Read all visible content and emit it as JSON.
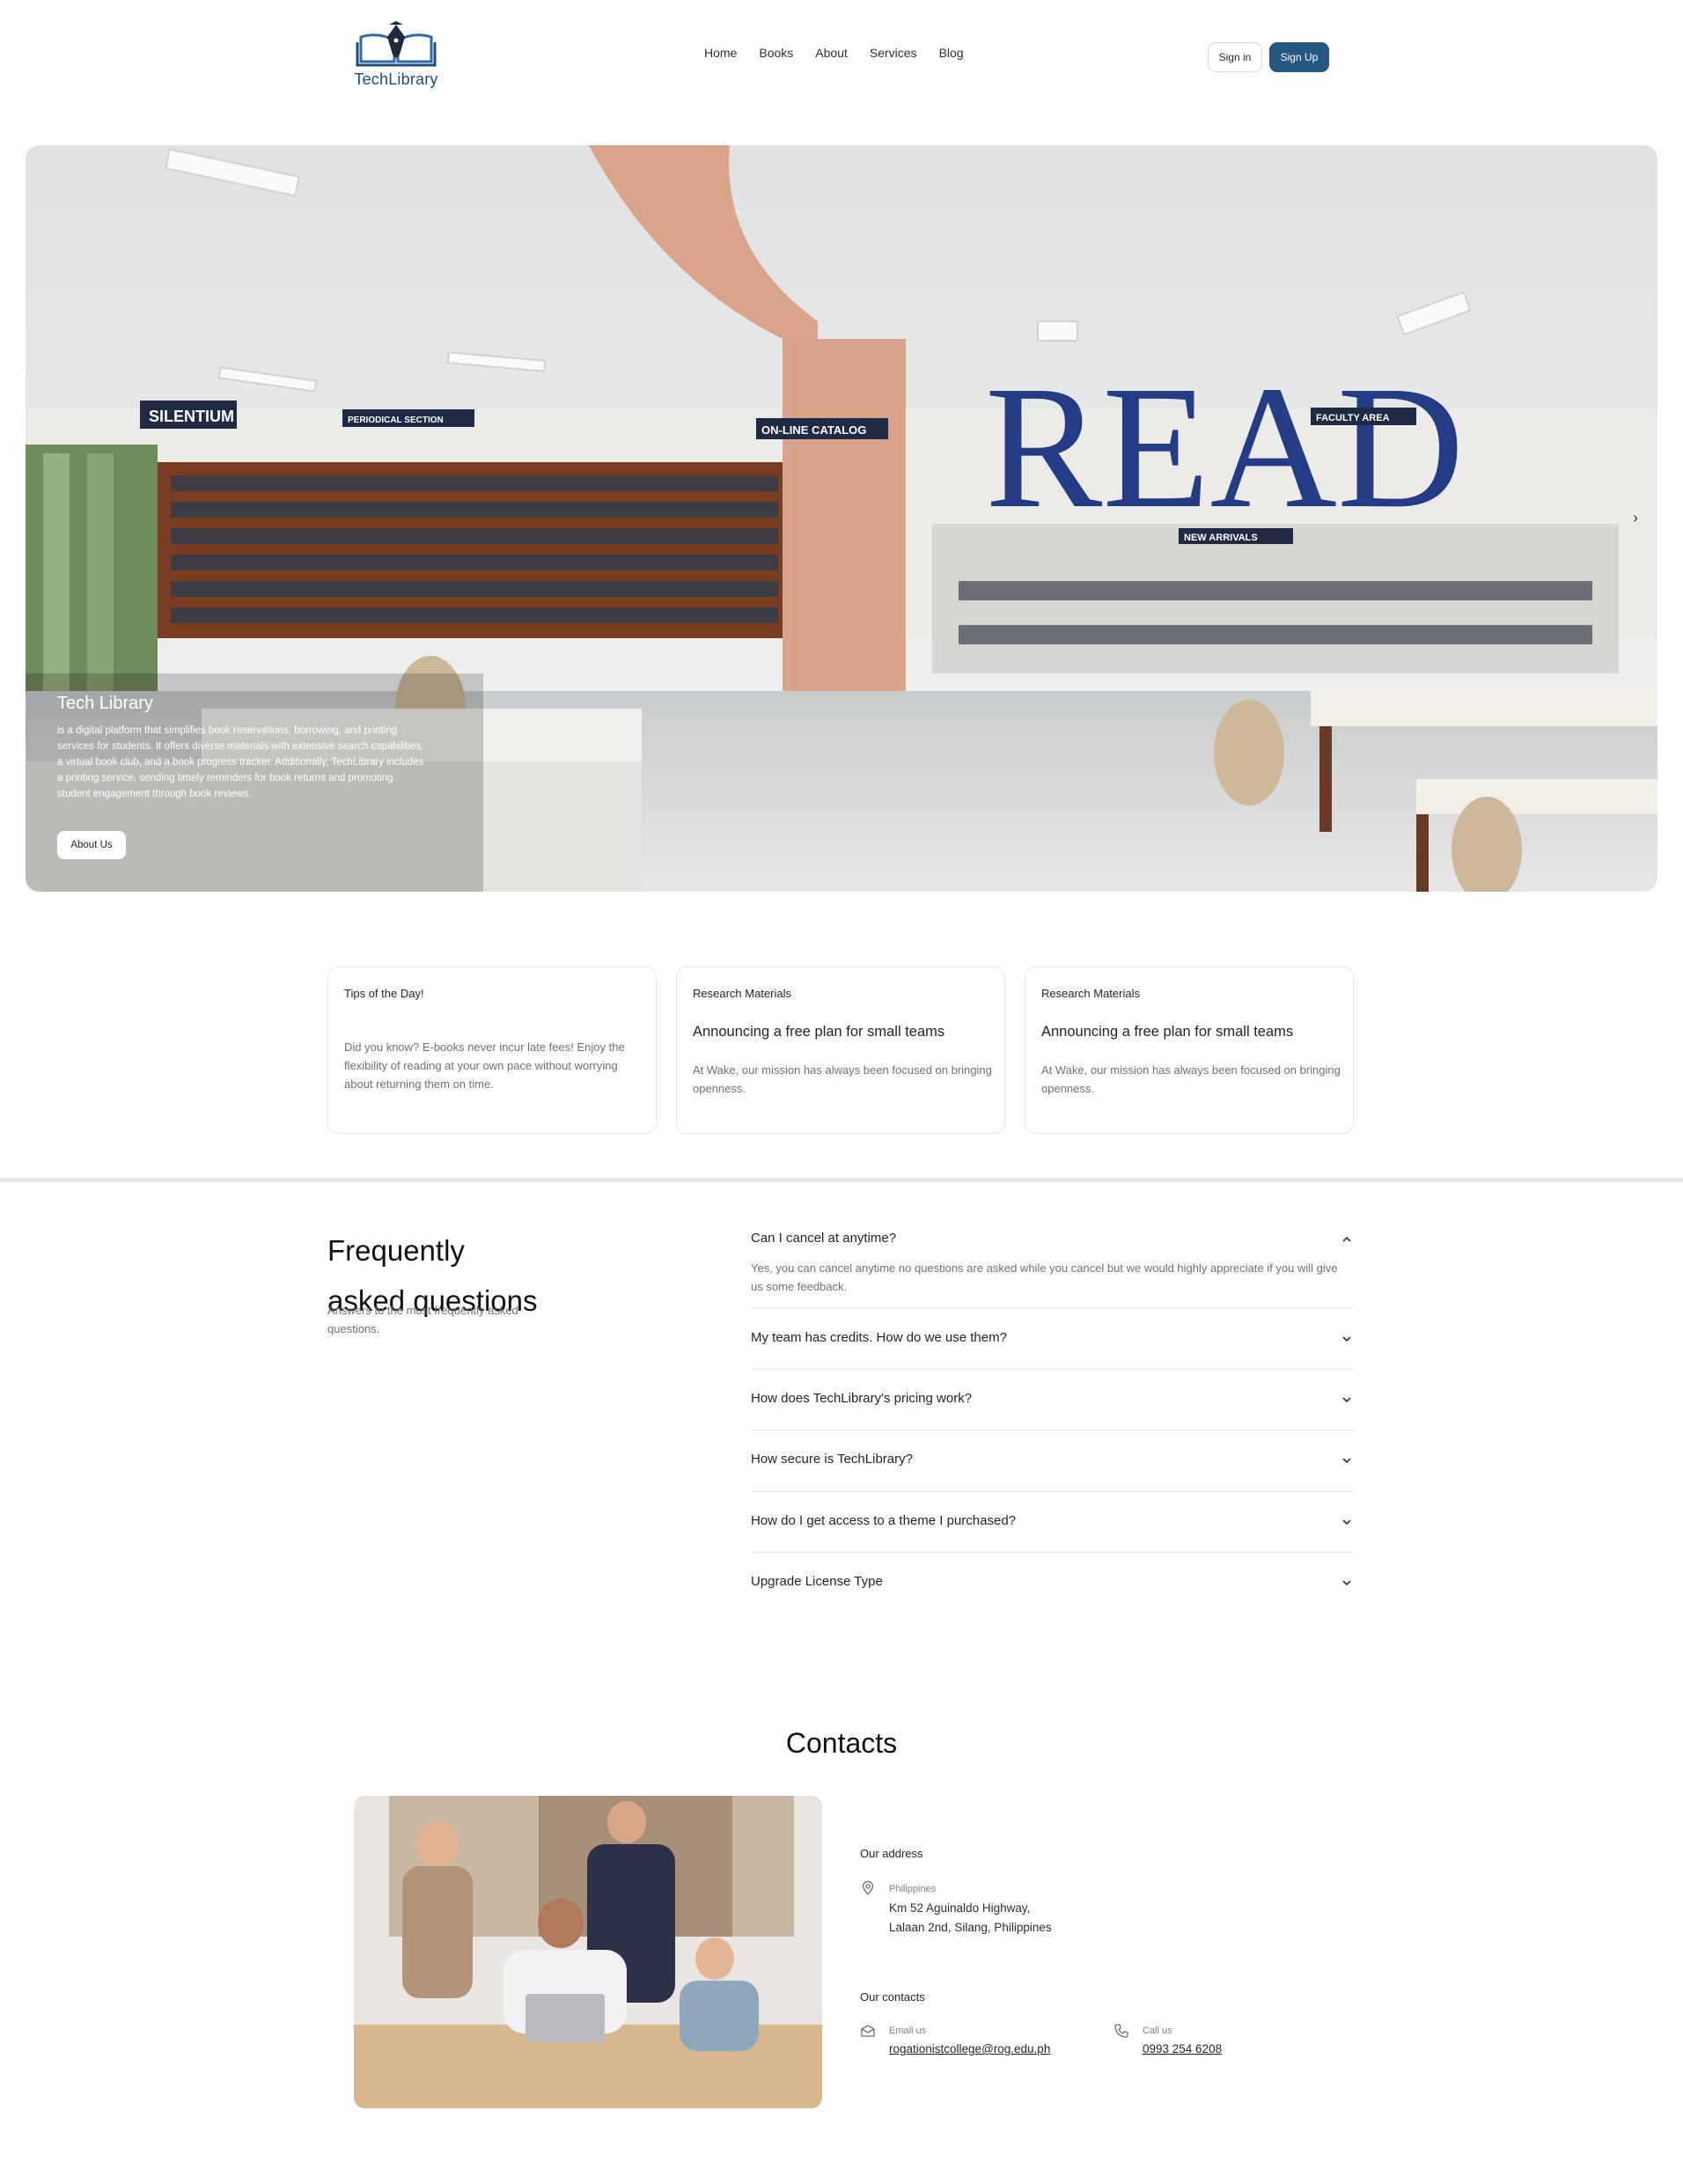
{
  "brand": {
    "name": "TechLibrary",
    "accent": "#255780"
  },
  "nav": {
    "items": [
      "Home",
      "Books",
      "About",
      "Services",
      "Blog"
    ]
  },
  "auth": {
    "signin_label": "Sign in",
    "signup_label": "Sign Up"
  },
  "hero": {
    "title": "Tech Library",
    "description": "is a digital platform that simplifies book reservations, borrowing, and printing services for students. It offers diverse materials with extensive search capabilities, a virtual book club, and a book progress tracker. Additionally, TechLibrary includes a printing service, sending timely reminders for book returns and promoting student engagement through book reviews.",
    "button_label": "About Us",
    "photo_signs": {
      "silentium": "SILENTIUM",
      "periodical": "PERIODICAL SECTION",
      "catalog": "ON-LINE CATALOG",
      "faculty": "FACULTY AREA",
      "arrivals": "NEW ARRIVALS",
      "read": "READ"
    }
  },
  "cards": [
    {
      "category": "Tips of the Day!",
      "title": "",
      "text": "Did you know? E-books never incur late fees! Enjoy the flexibility of reading at your own pace without worrying about returning them on time."
    },
    {
      "category": "Research Materials",
      "title": "Announcing a free plan for small teams",
      "text": "At Wake, our mission has always been focused on bringing openness."
    },
    {
      "category": "Research Materials",
      "title": "Announcing a free plan for small teams",
      "text": "At Wake, our mission has always been focused on bringing openness."
    }
  ],
  "faq": {
    "title_line1": "Frequently",
    "title_line2": "asked questions",
    "subtitle": "Answers to the most frequently asked questions.",
    "items": [
      {
        "question": "Can I cancel at anytime?",
        "answer": "Yes, you can cancel anytime no questions are asked while you cancel but we would highly appreciate if you will give us some feedback.",
        "expanded": true
      },
      {
        "question": "My team has credits. How do we use them?",
        "answer": "",
        "expanded": false
      },
      {
        "question": "How does TechLibrary's pricing work?",
        "answer": "",
        "expanded": false
      },
      {
        "question": "How secure is TechLibrary?",
        "answer": "",
        "expanded": false
      },
      {
        "question": "How do I get access to a theme I purchased?",
        "answer": "",
        "expanded": false
      },
      {
        "question": "Upgrade License Type",
        "answer": "",
        "expanded": false
      }
    ]
  },
  "contacts": {
    "title": "Contacts",
    "address_heading": "Our address",
    "address_country": "Philippines",
    "address_line1": "Km 52 Aguinaldo Highway,",
    "address_line2": "Lalaan 2nd, Silang, Philippines",
    "contacts_heading": "Our contacts",
    "email_label": "Email us",
    "email": "rogationistcollege@rog.edu.ph",
    "phone_label": "Call us",
    "phone": "0993 254 6208"
  },
  "icons": [
    "pen-book-logo-icon",
    "chevron-right-icon",
    "chevron-up-icon",
    "chevron-down-icon",
    "map-pin-icon",
    "mail-icon",
    "phone-icon"
  ]
}
